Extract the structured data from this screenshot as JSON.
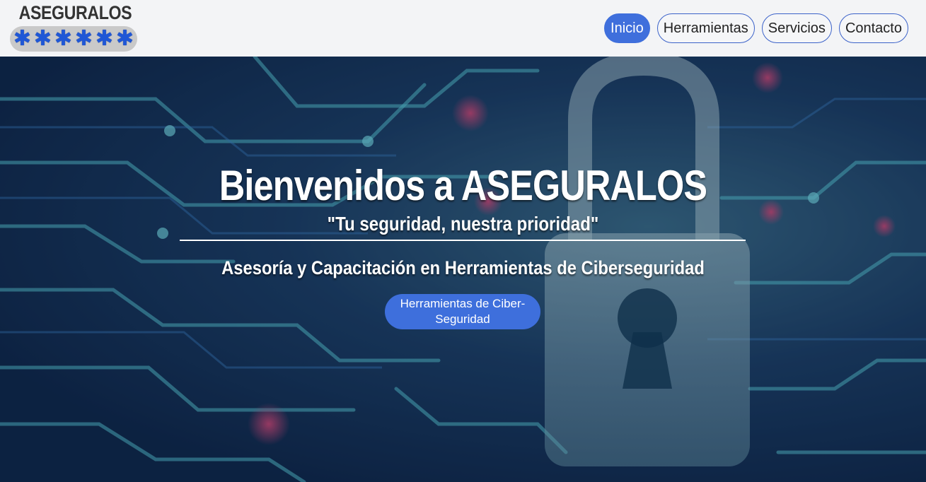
{
  "logo": {
    "text": "ASEGURALOS",
    "icon": "asterisk-row-icon",
    "stars": [
      "✱",
      "✱",
      "✱",
      "✱",
      "✱",
      "✱"
    ]
  },
  "nav": {
    "items": [
      {
        "label": "Inicio",
        "active": true
      },
      {
        "label": "Herramientas",
        "active": false
      },
      {
        "label": "Servicios",
        "active": false
      },
      {
        "label": "Contacto",
        "active": false
      }
    ]
  },
  "hero": {
    "title": "Bienvenidos a ASEGURALOS",
    "slogan": "\"Tu seguridad, nuestra prioridad\"",
    "subtitle": "Asesoría y Capacitación en Herramientas de Ciberseguridad",
    "cta_label": "Herramientas de Ciber-Seguridad",
    "background": "circuit-padlock-image"
  },
  "colors": {
    "accent": "#3f6fdc",
    "header_bg": "#f3f4f6"
  }
}
